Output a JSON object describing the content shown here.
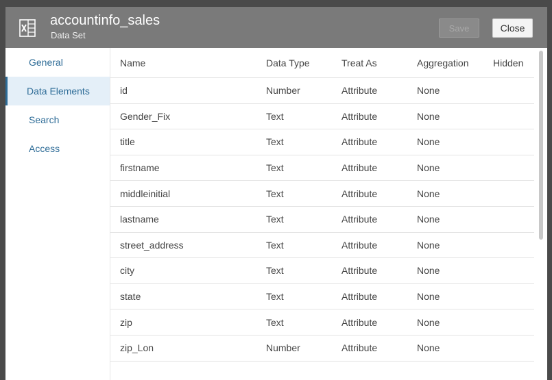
{
  "header": {
    "title": "accountinfo_sales",
    "subtitle": "Data Set",
    "icon": "excel-file-icon",
    "save_label": "Save",
    "close_label": "Close"
  },
  "sidebar": {
    "items": [
      {
        "label": "General",
        "active": false
      },
      {
        "label": "Data Elements",
        "active": true
      },
      {
        "label": "Search",
        "active": false
      },
      {
        "label": "Access",
        "active": false
      }
    ]
  },
  "table": {
    "columns": {
      "name": "Name",
      "data_type": "Data Type",
      "treat_as": "Treat As",
      "aggregation": "Aggregation",
      "hidden": "Hidden"
    },
    "rows": [
      {
        "name": "id",
        "data_type": "Number",
        "treat_as": "Attribute",
        "aggregation": "None"
      },
      {
        "name": "Gender_Fix",
        "data_type": "Text",
        "treat_as": "Attribute",
        "aggregation": "None"
      },
      {
        "name": "title",
        "data_type": "Text",
        "treat_as": "Attribute",
        "aggregation": "None"
      },
      {
        "name": "firstname",
        "data_type": "Text",
        "treat_as": "Attribute",
        "aggregation": "None"
      },
      {
        "name": "middleinitial",
        "data_type": "Text",
        "treat_as": "Attribute",
        "aggregation": "None"
      },
      {
        "name": "lastname",
        "data_type": "Text",
        "treat_as": "Attribute",
        "aggregation": "None"
      },
      {
        "name": "street_address",
        "data_type": "Text",
        "treat_as": "Attribute",
        "aggregation": "None"
      },
      {
        "name": "city",
        "data_type": "Text",
        "treat_as": "Attribute",
        "aggregation": "None"
      },
      {
        "name": "state",
        "data_type": "Text",
        "treat_as": "Attribute",
        "aggregation": "None"
      },
      {
        "name": "zip",
        "data_type": "Text",
        "treat_as": "Attribute",
        "aggregation": "None"
      },
      {
        "name": "zip_Lon",
        "data_type": "Number",
        "treat_as": "Attribute",
        "aggregation": "None"
      }
    ]
  },
  "colors": {
    "header_bg": "#7a7a7a",
    "frame": "#4a4a4a",
    "accent": "#2e6c97",
    "active_bg": "#e4eff8"
  }
}
